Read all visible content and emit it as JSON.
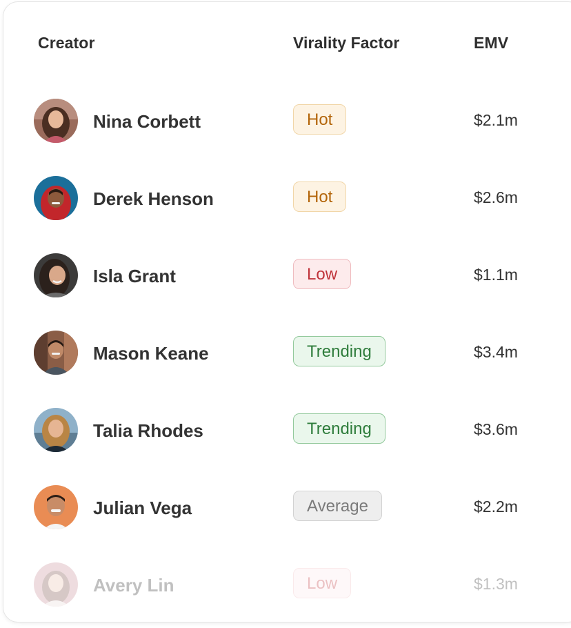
{
  "table": {
    "headers": {
      "creator": "Creator",
      "virality": "Virality Factor",
      "emv": "EMV"
    },
    "rows": [
      {
        "name": "Nina Corbett",
        "virality": "Hot",
        "virality_level": "hot",
        "emv": "$2.1m"
      },
      {
        "name": "Derek Henson",
        "virality": "Hot",
        "virality_level": "hot",
        "emv": "$2.6m"
      },
      {
        "name": "Isla Grant",
        "virality": "Low",
        "virality_level": "low",
        "emv": "$1.1m"
      },
      {
        "name": "Mason Keane",
        "virality": "Trending",
        "virality_level": "trending",
        "emv": "$3.4m"
      },
      {
        "name": "Talia Rhodes",
        "virality": "Trending",
        "virality_level": "trending",
        "emv": "$3.6m"
      },
      {
        "name": "Julian Vega",
        "virality": "Average",
        "virality_level": "average",
        "emv": "$2.2m"
      },
      {
        "name": "Avery Lin",
        "virality": "Low",
        "virality_level": "low",
        "emv": "$1.3m",
        "faded": true
      }
    ]
  },
  "colors": {
    "hot": "#b3650a",
    "low": "#c0343b",
    "trending": "#2f7d3c",
    "average": "#7a7a7a"
  }
}
